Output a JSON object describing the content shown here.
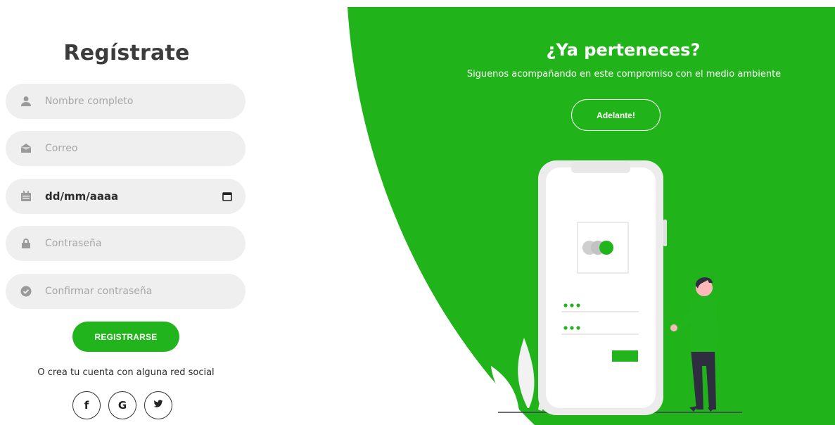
{
  "register": {
    "title": "Regístrate",
    "fields": [
      {
        "icon": "user-icon",
        "placeholder": "Nombre completo"
      },
      {
        "icon": "envelope-icon",
        "placeholder": "Correo"
      },
      {
        "icon": "calendar-icon",
        "value": "dd/mm/aaaa"
      },
      {
        "icon": "lock-icon",
        "placeholder": "Contraseña"
      },
      {
        "icon": "check-circle-icon",
        "placeholder": "Confirmar contraseña"
      }
    ],
    "submit_label": "REGISTRARSE",
    "social_text": "O crea tu cuenta con alguna red social",
    "social": [
      {
        "icon": "facebook-icon",
        "label": "f"
      },
      {
        "icon": "google-icon",
        "label": "G"
      },
      {
        "icon": "twitter-icon"
      }
    ]
  },
  "login_panel": {
    "title": "¿Ya perteneces?",
    "subtitle": "Siguenos acompañando en este compromiso con el medio ambiente",
    "button_label": "Adelante!"
  },
  "colors": {
    "brand_green": "#22b41c",
    "field_bg": "#efefef"
  }
}
